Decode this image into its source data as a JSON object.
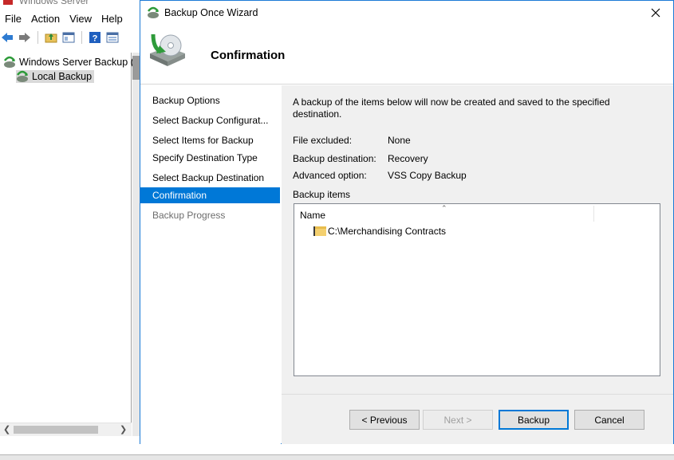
{
  "mmc": {
    "title": "Windows Server",
    "menu": [
      "File",
      "Action",
      "View",
      "Help"
    ],
    "toolbar_icons": [
      "back-arrow-icon",
      "forward-arrow-icon",
      "folder-up-icon",
      "show-hide-tree-icon",
      "help-icon",
      "properties-icon"
    ],
    "tree": {
      "root_label": "Windows Server Backup (L",
      "child_label": "Local Backup"
    }
  },
  "wizard": {
    "title": "Backup Once Wizard",
    "header_title": "Confirmation",
    "steps": [
      {
        "label": "Backup Options",
        "state": "done"
      },
      {
        "label": "Select Backup Configurat...",
        "state": "done"
      },
      {
        "label": "Select Items for Backup",
        "state": "done"
      },
      {
        "label": "Specify Destination Type",
        "state": "done"
      },
      {
        "label": "Select Backup Destination",
        "state": "done"
      },
      {
        "label": "Confirmation",
        "state": "active"
      },
      {
        "label": "Backup Progress",
        "state": "disabled"
      }
    ],
    "intro": "A backup of the items below will now be created and saved to the specified destination.",
    "details": {
      "file_excluded_label": "File excluded:",
      "file_excluded_value": "None",
      "backup_destination_label": "Backup destination:",
      "backup_destination_value": "Recovery",
      "advanced_option_label": "Advanced option:",
      "advanced_option_value": "VSS Copy Backup"
    },
    "items_label": "Backup items",
    "list_header": "Name",
    "items": [
      "C:\\Merchandising Contracts"
    ],
    "buttons": {
      "previous": "< Previous",
      "next": "Next >",
      "backup": "Backup",
      "cancel": "Cancel"
    },
    "colors": {
      "accent": "#0078d7",
      "panel": "#f0f0f0"
    }
  }
}
